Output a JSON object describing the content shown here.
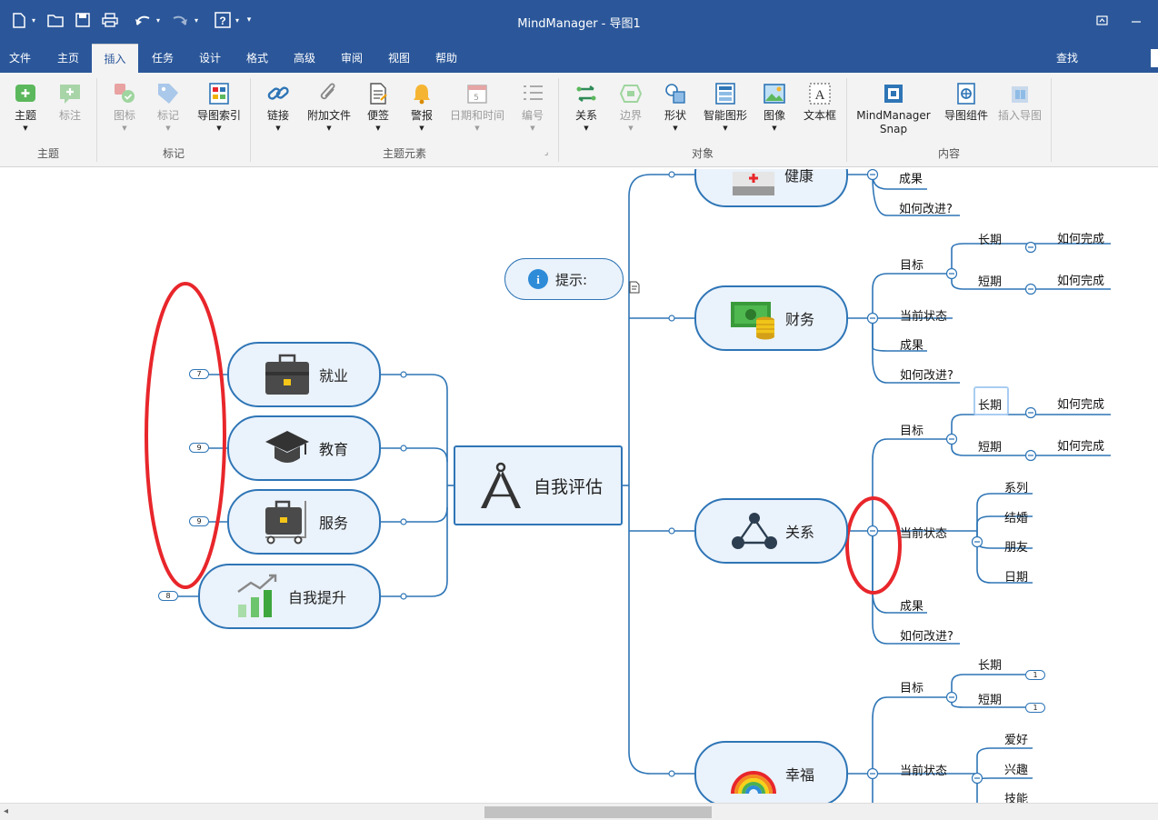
{
  "window": {
    "title": "MindManager - 导图1",
    "search_label": "查找"
  },
  "menu": {
    "tabs": [
      "文件",
      "主页",
      "插入",
      "任务",
      "设计",
      "格式",
      "高级",
      "审阅",
      "视图",
      "帮助"
    ],
    "active": "插入"
  },
  "ribbon": {
    "buttons": {
      "topic": "主题",
      "callout": "标注",
      "icon": "图标",
      "tag": "标记",
      "map_index": "导图索引",
      "link": "链接",
      "attach": "附加文件",
      "note": "便签",
      "alarm": "警报",
      "datetime": "日期和时间",
      "numbering": "编号",
      "relation": "关系",
      "boundary": "边界",
      "shape": "形状",
      "smart_shape": "智能图形",
      "image": "图像",
      "textbox": "文本框",
      "snap_line1": "MindManager",
      "snap_line2": "Snap",
      "map_part": "导图组件",
      "insert_map": "插入导图"
    },
    "groups": {
      "topic": "主题",
      "markers": "标记",
      "elements": "主题元素",
      "objects": "对象",
      "content": "内容"
    }
  },
  "map": {
    "central": "自我评估",
    "hint": "提示:",
    "left_topics": [
      {
        "label": "就业",
        "badge": "7"
      },
      {
        "label": "教育",
        "badge": "9"
      },
      {
        "label": "服务",
        "badge": "9"
      },
      {
        "label": "自我提升",
        "badge": "8"
      }
    ],
    "right_topics": {
      "health": "健康",
      "finance": "财务",
      "relation": "关系",
      "happiness": "幸福"
    },
    "health_subs": {
      "result": "成果",
      "improve": "如何改进?"
    },
    "finance_subs": {
      "goal": "目标",
      "long": "长期",
      "short": "短期",
      "how1": "如何完成",
      "how2": "如何完成",
      "status": "当前状态",
      "result": "成果",
      "improve": "如何改进?"
    },
    "relation_subs": {
      "goal": "目标",
      "long": "长期",
      "short": "短期",
      "how1": "如何完成",
      "how2": "如何完成",
      "status": "当前状态",
      "s1": "系列",
      "s2": "结婚",
      "s3": "朋友",
      "s4": "日期",
      "result": "成果",
      "improve": "如何改进?"
    },
    "happiness_subs": {
      "goal": "目标",
      "long": "长期",
      "short": "短期",
      "long_badge": "1",
      "short_badge": "1",
      "status": "当前状态",
      "s1": "爱好",
      "s2": "兴趣",
      "s3": "技能"
    }
  },
  "colors": {
    "brand": "#2b579a",
    "branch": "#2e75b6",
    "topic_fill": "#eaf2fb",
    "highlight": "#e8262b"
  }
}
